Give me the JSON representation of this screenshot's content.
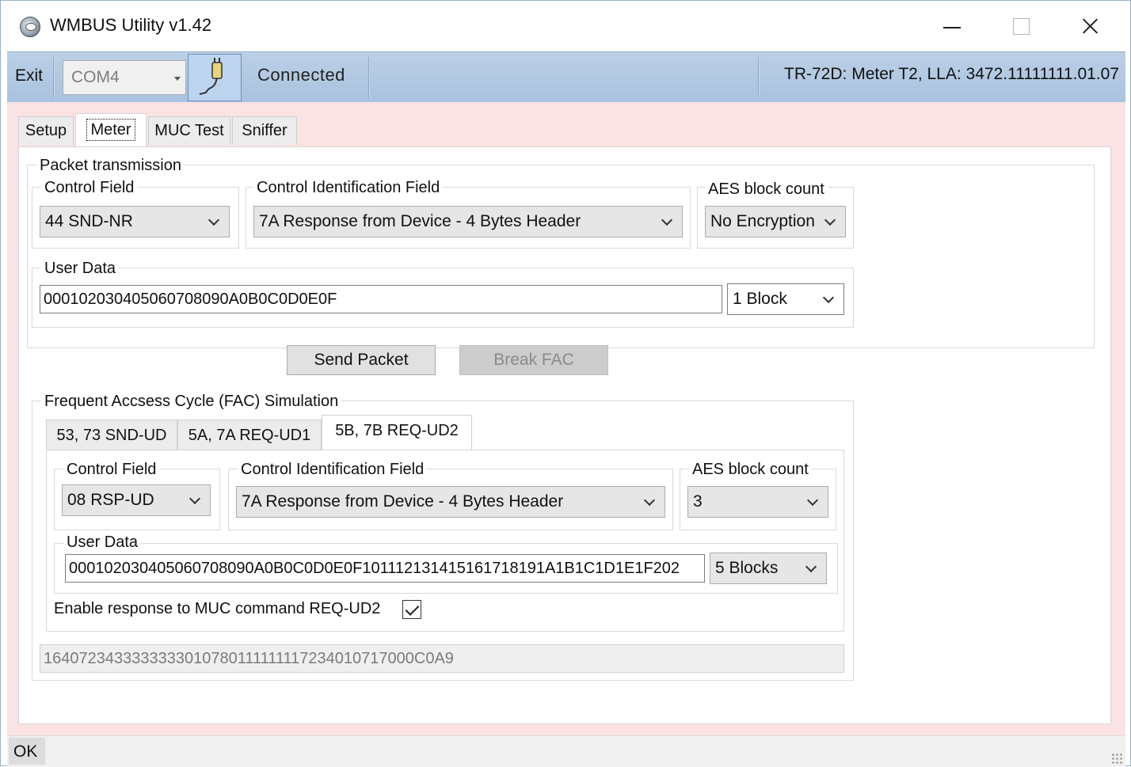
{
  "window": {
    "title": "WMBUS Utility v1.42"
  },
  "toolbar": {
    "exit_label": "Exit",
    "port_value": "COM4",
    "status": "Connected",
    "meter_info": "TR-72D: Meter T2, LLA: 3472.11111111.01.07"
  },
  "tabs": [
    {
      "label": "Setup"
    },
    {
      "label": "Meter"
    },
    {
      "label": "MUC Test"
    },
    {
      "label": "Sniffer"
    }
  ],
  "packet": {
    "group_label": "Packet transmission",
    "control_field_label": "Control Field",
    "control_field_value": "44 SND-NR",
    "ci_field_label": "Control Identification Field",
    "ci_field_value": "7A Response from Device - 4 Bytes Header",
    "aes_label": "AES block count",
    "aes_value": "No Encryption",
    "user_data_label": "User Data",
    "user_data_value": "000102030405060708090A0B0C0D0E0F",
    "blocks_value": "1 Block",
    "send_label": "Send Packet",
    "break_label": "Break FAC"
  },
  "fac": {
    "group_label": "Frequent Accsess Cycle (FAC) Simulation",
    "subtabs": [
      {
        "label": "53, 73 SND-UD"
      },
      {
        "label": "5A, 7A REQ-UD1"
      },
      {
        "label": "5B, 7B REQ-UD2"
      }
    ],
    "control_field_label": "Control Field",
    "control_field_value": "08 RSP-UD",
    "ci_field_label": "Control Identification Field",
    "ci_field_value": "7A Response from Device - 4 Bytes Header",
    "aes_label": "AES block count",
    "aes_value": "3",
    "user_data_label": "User Data",
    "user_data_value": "000102030405060708090A0B0C0D0E0F101112131415161718191A1B1C1D1E1F202",
    "blocks_value": "5 Blocks",
    "enable_label": "Enable response to MUC command REQ-UD2",
    "enable_checked": true,
    "output_value": "1640723433333333010780111111117234010717000C0A9"
  },
  "statusbar": {
    "text": "OK"
  }
}
